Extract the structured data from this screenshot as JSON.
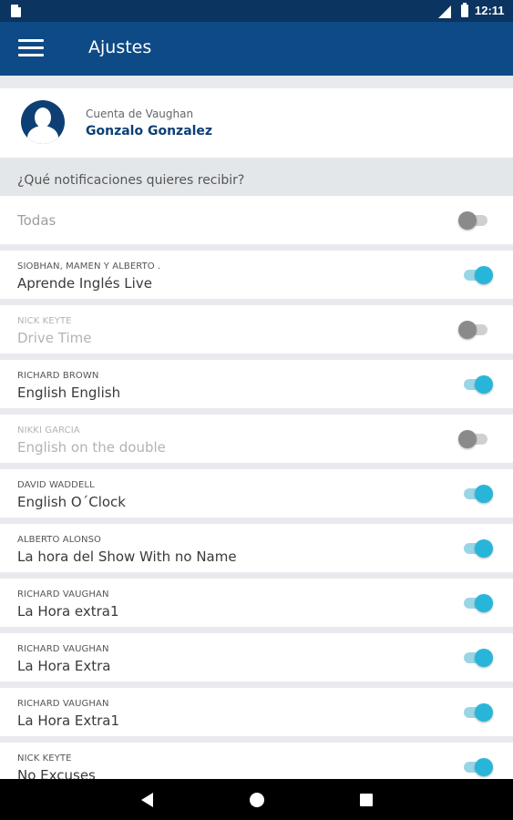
{
  "status_bar": {
    "time": "12:11",
    "icons": [
      "sd-card-icon",
      "signal-icon",
      "battery-icon"
    ]
  },
  "app_bar": {
    "title": "Ajustes",
    "menu_icon": "menu-icon"
  },
  "account": {
    "label": "Cuenta de Vaughan",
    "name": "Gonzalo Gonzalez",
    "avatar_icon": "person-icon"
  },
  "notifications": {
    "header": "¿Qué notificaciones quieres recibir?",
    "all_label": "Todas",
    "all_enabled": false,
    "items": [
      {
        "author": "Siobhan, Mamen y Alberto .",
        "show": "Aprende Inglés Live",
        "enabled": true
      },
      {
        "author": "Nick Keyte",
        "show": "Drive Time",
        "enabled": false
      },
      {
        "author": "Richard Brown",
        "show": "English English",
        "enabled": true
      },
      {
        "author": "Nikki Garcia",
        "show": "English on the double",
        "enabled": false
      },
      {
        "author": "David Waddell",
        "show": "English O´Clock",
        "enabled": true
      },
      {
        "author": "Alberto Alonso",
        "show": "La hora del Show With no Name",
        "enabled": true
      },
      {
        "author": "Richard Vaughan",
        "show": "La Hora extra1",
        "enabled": true
      },
      {
        "author": "Richard Vaughan",
        "show": "La Hora Extra",
        "enabled": true
      },
      {
        "author": "Richard Vaughan",
        "show": "La Hora Extra1",
        "enabled": true
      },
      {
        "author": "Nick Keyte",
        "show": "No Excuses",
        "enabled": true
      }
    ]
  },
  "colors": {
    "app_bar": "#0d4a86",
    "status_bar": "#0b3460",
    "toggle_on": "#27b6da",
    "toggle_off": "#8a8a8a",
    "account_name": "#0d3f74"
  },
  "nav_bar": {
    "icons": [
      "back-icon",
      "home-icon",
      "recents-icon"
    ]
  }
}
